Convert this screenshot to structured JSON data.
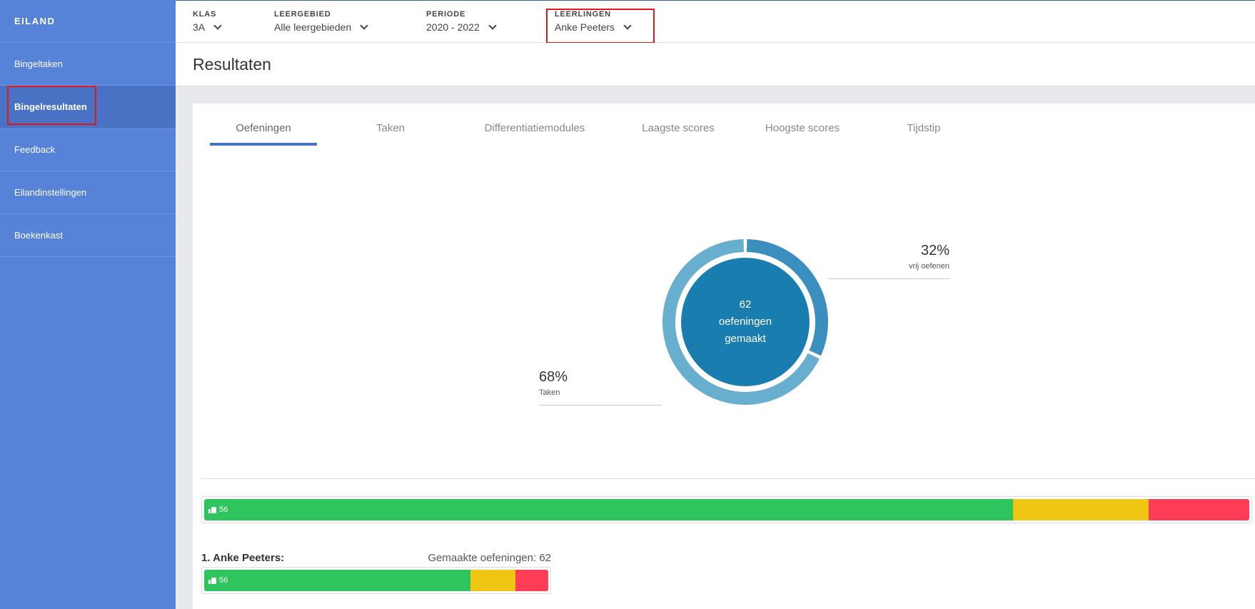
{
  "sidebar": {
    "brand": "EILAND",
    "items": [
      {
        "label": "Bingeltaken",
        "active": false
      },
      {
        "label": "Bingelresultaten",
        "active": true
      },
      {
        "label": "Feedback",
        "active": false
      },
      {
        "label": "Eilandinstellingen",
        "active": false
      },
      {
        "label": "Boekenkast",
        "active": false
      }
    ]
  },
  "filters": {
    "klas": {
      "label": "KLAS",
      "value": "3A"
    },
    "leergebied": {
      "label": "LEERGEBIED",
      "value": "Alle leergebieden"
    },
    "periode": {
      "label": "PERIODE",
      "value": "2020 - 2022"
    },
    "leerlingen": {
      "label": "LEERLINGEN",
      "value": "Anke Peeters"
    }
  },
  "page": {
    "title": "Resultaten"
  },
  "tabs": [
    {
      "label": "Oefeningen",
      "active": true
    },
    {
      "label": "Taken",
      "active": false
    },
    {
      "label": "Differentiatiemodules",
      "active": false
    },
    {
      "label": "Laagste scores",
      "active": false
    },
    {
      "label": "Hoogste scores",
      "active": false
    },
    {
      "label": "Tijdstip",
      "active": false
    }
  ],
  "donut": {
    "center_value": "62",
    "center_line1": "oefeningen",
    "center_line2": "gemaakt",
    "slices": [
      {
        "label": "vrij oefenen",
        "percent_label": "32%",
        "value": 32,
        "color": "#3a8fbf"
      },
      {
        "label": "Taken",
        "percent_label": "68%",
        "value": 68,
        "color": "#68aecf"
      }
    ]
  },
  "overall_bar": {
    "green_label": "56",
    "segments": {
      "green": 77.4,
      "yellow": 13,
      "red": 9.6
    }
  },
  "students": [
    {
      "name": "1. Anke Peeters:",
      "count_label": "Gemaakte oefeningen: 62",
      "green_label": "56",
      "segments": {
        "green": 77.4,
        "yellow": 13,
        "red": 9.6
      }
    }
  ],
  "colors": {
    "sidebar": "#5682d8",
    "accent": "#4a72c4",
    "green": "#2ec45e",
    "yellow": "#f0c514",
    "red": "#fd3d55",
    "highlight": "#e0191e"
  }
}
